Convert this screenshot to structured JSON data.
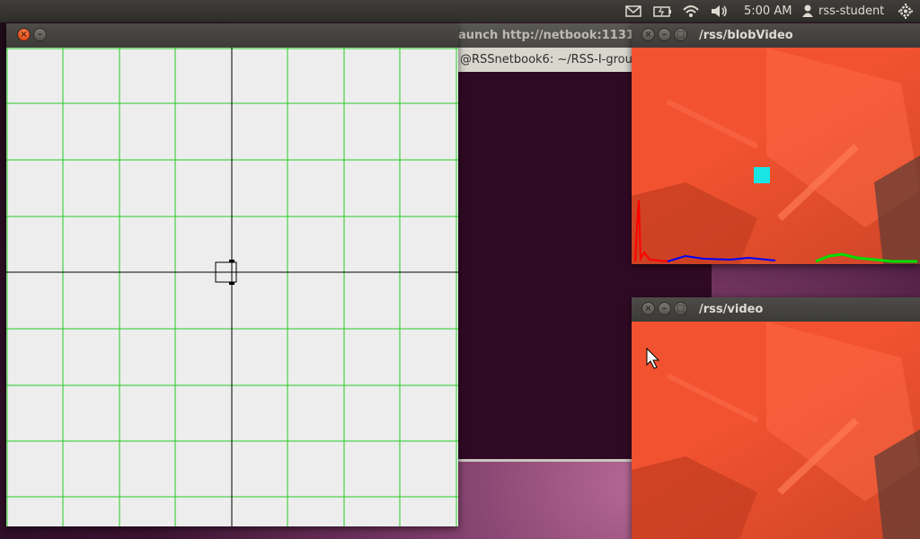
{
  "top_panel": {
    "clock": "5:00 AM",
    "user": "rss-student",
    "icons": [
      "mail-icon",
      "battery-icon",
      "wifi-icon",
      "volume-icon",
      "user-icon",
      "settings-gear-icon"
    ]
  },
  "terminal_window": {
    "title": "aunch http://netbook:1131",
    "prompt_line": "@RSSnetbook6: ~/RSS-I-grou"
  },
  "grid_window": {
    "title": "",
    "grid_color": "#22cc22",
    "background_color": "#ededed"
  },
  "blob_video_window": {
    "title": "/rss/blobVideo",
    "blob_marker_color": "#19e5e5",
    "histogram_colors": [
      "#ff0000",
      "#0000ff",
      "#00dd00"
    ]
  },
  "video_window": {
    "title": "/rss/video"
  },
  "colors": {
    "ubuntu_close": "#dd4814",
    "terminal_bg": "#300a24",
    "object_red": "#f2522f"
  }
}
